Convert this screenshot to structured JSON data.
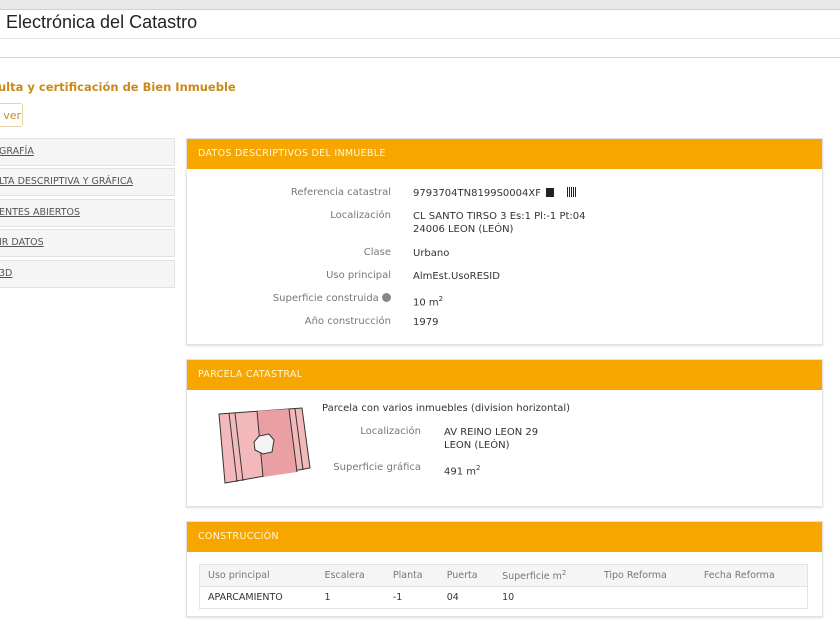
{
  "header": {
    "title": "Electrónica del Catastro"
  },
  "page": {
    "heading": "ulta y certificación de Bien Inmueble",
    "back_label": "ver"
  },
  "sidebar": {
    "items": [
      {
        "label": "GRAFÍA"
      },
      {
        "label": "LTA DESCRIPTIVA Y GRÁFICA"
      },
      {
        "label": "ENTES ABIERTOS"
      },
      {
        "label": "IR DATOS"
      },
      {
        "label": "3D"
      }
    ]
  },
  "datos": {
    "title": "DATOS DESCRIPTIVOS DEL INMUEBLE",
    "ref_label": "Referencia catastral",
    "ref": "9793704TN8199S0004XF",
    "loc_label": "Localización",
    "loc1": "CL SANTO TIRSO 3 Es:1 Pl:-1 Pt:04",
    "loc2": "24006 LEON (LEÓN)",
    "clase_label": "Clase",
    "clase": "Urbano",
    "uso_label": "Uso principal",
    "uso": "AlmEst.UsoRESID",
    "sup_label": "Superficie construida",
    "sup": "10 m",
    "sup_unit_exp": "2",
    "anio_label": "Año construcción",
    "anio": "1979"
  },
  "parcela": {
    "title": "PARCELA CATASTRAL",
    "desc": "Parcela con varios inmuebles (division horizontal)",
    "loc_label": "Localización",
    "loc1": "AV REINO LEON 29",
    "loc2": "LEON (LEÓN)",
    "sup_label": "Superficie gráfica",
    "sup": "491 m",
    "sup_unit_exp": "2"
  },
  "construccion": {
    "title": "CONSTRUCCIÓN",
    "columns": [
      "Uso principal",
      "Escalera",
      "Planta",
      "Puerta",
      "Superficie m",
      "Tipo Reforma",
      "Fecha Reforma"
    ],
    "sup_exp": "2",
    "rows": [
      [
        "APARCAMIENTO",
        "1",
        "-1",
        "04",
        "10",
        "",
        ""
      ]
    ]
  }
}
